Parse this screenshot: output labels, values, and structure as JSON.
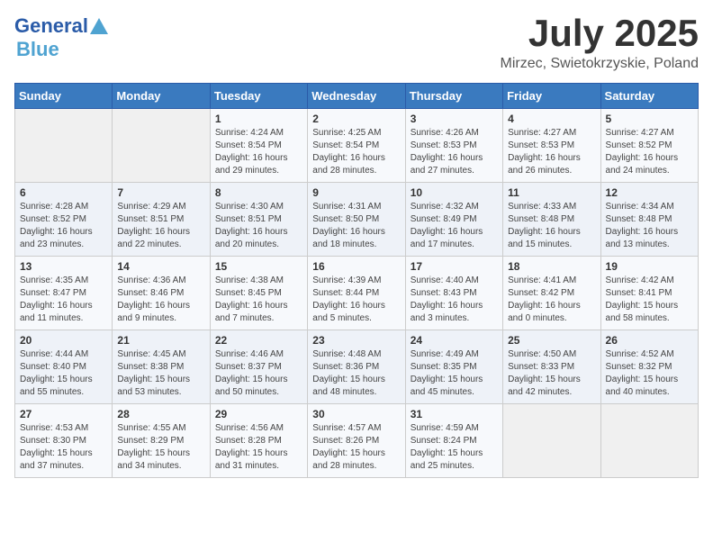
{
  "header": {
    "logo_general": "General",
    "logo_blue": "Blue",
    "month_title": "July 2025",
    "location": "Mirzec, Swietokrzyskie, Poland"
  },
  "days_of_week": [
    "Sunday",
    "Monday",
    "Tuesday",
    "Wednesday",
    "Thursday",
    "Friday",
    "Saturday"
  ],
  "weeks": [
    [
      {
        "day": null
      },
      {
        "day": null
      },
      {
        "day": "1",
        "sunrise": "Sunrise: 4:24 AM",
        "sunset": "Sunset: 8:54 PM",
        "daylight": "Daylight: 16 hours and 29 minutes."
      },
      {
        "day": "2",
        "sunrise": "Sunrise: 4:25 AM",
        "sunset": "Sunset: 8:54 PM",
        "daylight": "Daylight: 16 hours and 28 minutes."
      },
      {
        "day": "3",
        "sunrise": "Sunrise: 4:26 AM",
        "sunset": "Sunset: 8:53 PM",
        "daylight": "Daylight: 16 hours and 27 minutes."
      },
      {
        "day": "4",
        "sunrise": "Sunrise: 4:27 AM",
        "sunset": "Sunset: 8:53 PM",
        "daylight": "Daylight: 16 hours and 26 minutes."
      },
      {
        "day": "5",
        "sunrise": "Sunrise: 4:27 AM",
        "sunset": "Sunset: 8:52 PM",
        "daylight": "Daylight: 16 hours and 24 minutes."
      }
    ],
    [
      {
        "day": "6",
        "sunrise": "Sunrise: 4:28 AM",
        "sunset": "Sunset: 8:52 PM",
        "daylight": "Daylight: 16 hours and 23 minutes."
      },
      {
        "day": "7",
        "sunrise": "Sunrise: 4:29 AM",
        "sunset": "Sunset: 8:51 PM",
        "daylight": "Daylight: 16 hours and 22 minutes."
      },
      {
        "day": "8",
        "sunrise": "Sunrise: 4:30 AM",
        "sunset": "Sunset: 8:51 PM",
        "daylight": "Daylight: 16 hours and 20 minutes."
      },
      {
        "day": "9",
        "sunrise": "Sunrise: 4:31 AM",
        "sunset": "Sunset: 8:50 PM",
        "daylight": "Daylight: 16 hours and 18 minutes."
      },
      {
        "day": "10",
        "sunrise": "Sunrise: 4:32 AM",
        "sunset": "Sunset: 8:49 PM",
        "daylight": "Daylight: 16 hours and 17 minutes."
      },
      {
        "day": "11",
        "sunrise": "Sunrise: 4:33 AM",
        "sunset": "Sunset: 8:48 PM",
        "daylight": "Daylight: 16 hours and 15 minutes."
      },
      {
        "day": "12",
        "sunrise": "Sunrise: 4:34 AM",
        "sunset": "Sunset: 8:48 PM",
        "daylight": "Daylight: 16 hours and 13 minutes."
      }
    ],
    [
      {
        "day": "13",
        "sunrise": "Sunrise: 4:35 AM",
        "sunset": "Sunset: 8:47 PM",
        "daylight": "Daylight: 16 hours and 11 minutes."
      },
      {
        "day": "14",
        "sunrise": "Sunrise: 4:36 AM",
        "sunset": "Sunset: 8:46 PM",
        "daylight": "Daylight: 16 hours and 9 minutes."
      },
      {
        "day": "15",
        "sunrise": "Sunrise: 4:38 AM",
        "sunset": "Sunset: 8:45 PM",
        "daylight": "Daylight: 16 hours and 7 minutes."
      },
      {
        "day": "16",
        "sunrise": "Sunrise: 4:39 AM",
        "sunset": "Sunset: 8:44 PM",
        "daylight": "Daylight: 16 hours and 5 minutes."
      },
      {
        "day": "17",
        "sunrise": "Sunrise: 4:40 AM",
        "sunset": "Sunset: 8:43 PM",
        "daylight": "Daylight: 16 hours and 3 minutes."
      },
      {
        "day": "18",
        "sunrise": "Sunrise: 4:41 AM",
        "sunset": "Sunset: 8:42 PM",
        "daylight": "Daylight: 16 hours and 0 minutes."
      },
      {
        "day": "19",
        "sunrise": "Sunrise: 4:42 AM",
        "sunset": "Sunset: 8:41 PM",
        "daylight": "Daylight: 15 hours and 58 minutes."
      }
    ],
    [
      {
        "day": "20",
        "sunrise": "Sunrise: 4:44 AM",
        "sunset": "Sunset: 8:40 PM",
        "daylight": "Daylight: 15 hours and 55 minutes."
      },
      {
        "day": "21",
        "sunrise": "Sunrise: 4:45 AM",
        "sunset": "Sunset: 8:38 PM",
        "daylight": "Daylight: 15 hours and 53 minutes."
      },
      {
        "day": "22",
        "sunrise": "Sunrise: 4:46 AM",
        "sunset": "Sunset: 8:37 PM",
        "daylight": "Daylight: 15 hours and 50 minutes."
      },
      {
        "day": "23",
        "sunrise": "Sunrise: 4:48 AM",
        "sunset": "Sunset: 8:36 PM",
        "daylight": "Daylight: 15 hours and 48 minutes."
      },
      {
        "day": "24",
        "sunrise": "Sunrise: 4:49 AM",
        "sunset": "Sunset: 8:35 PM",
        "daylight": "Daylight: 15 hours and 45 minutes."
      },
      {
        "day": "25",
        "sunrise": "Sunrise: 4:50 AM",
        "sunset": "Sunset: 8:33 PM",
        "daylight": "Daylight: 15 hours and 42 minutes."
      },
      {
        "day": "26",
        "sunrise": "Sunrise: 4:52 AM",
        "sunset": "Sunset: 8:32 PM",
        "daylight": "Daylight: 15 hours and 40 minutes."
      }
    ],
    [
      {
        "day": "27",
        "sunrise": "Sunrise: 4:53 AM",
        "sunset": "Sunset: 8:30 PM",
        "daylight": "Daylight: 15 hours and 37 minutes."
      },
      {
        "day": "28",
        "sunrise": "Sunrise: 4:55 AM",
        "sunset": "Sunset: 8:29 PM",
        "daylight": "Daylight: 15 hours and 34 minutes."
      },
      {
        "day": "29",
        "sunrise": "Sunrise: 4:56 AM",
        "sunset": "Sunset: 8:28 PM",
        "daylight": "Daylight: 15 hours and 31 minutes."
      },
      {
        "day": "30",
        "sunrise": "Sunrise: 4:57 AM",
        "sunset": "Sunset: 8:26 PM",
        "daylight": "Daylight: 15 hours and 28 minutes."
      },
      {
        "day": "31",
        "sunrise": "Sunrise: 4:59 AM",
        "sunset": "Sunset: 8:24 PM",
        "daylight": "Daylight: 15 hours and 25 minutes."
      },
      {
        "day": null
      },
      {
        "day": null
      }
    ]
  ]
}
